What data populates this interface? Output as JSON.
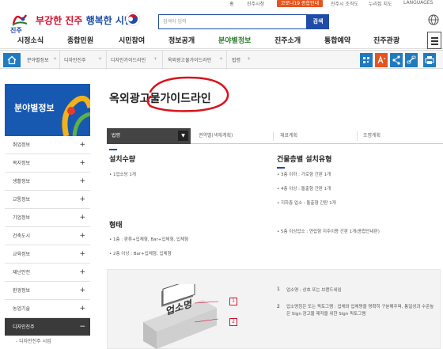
{
  "utility": {
    "home": "홈",
    "city_hall": "진주시청",
    "corona": "코로나19 종합안내",
    "org": "진주시 조직도",
    "sitemap": "누리집 지도",
    "languages": "LANGUAGES"
  },
  "header": {
    "logo_text": "진주",
    "slogan_red": "부강한 진주",
    "slogan_blue": "행복한 시민",
    "search_placeholder": "검색어 입력",
    "search_button": "검색"
  },
  "gnb": {
    "items": [
      "시정소식",
      "종합민원",
      "시민참여",
      "정보공개",
      "분야별정보",
      "진주소개",
      "통합예약",
      "진주관광"
    ],
    "active_index": 4
  },
  "breadcrumb": {
    "items": [
      "분야별정보",
      "디자인진주",
      "디자인가이드라인",
      "옥외광고물가이드라인",
      "법령"
    ]
  },
  "sidebar": {
    "title": "분야별정보",
    "items": [
      "취업정보",
      "복지정보",
      "생활정보",
      "교통정보",
      "기업정보",
      "건축도시",
      "교육정보",
      "재난안전",
      "환경정보",
      "농업기술",
      "디자인진주"
    ],
    "active_index": 10,
    "active_sign": "−",
    "sub_item": "- 디자인진주 시업"
  },
  "main": {
    "title": "옥외광고물가이드라인",
    "tabs": [
      "법령",
      "권역별(색채계획)",
      "재료계획",
      "조명계획"
    ],
    "tab_arrow": "▼",
    "section_qty": {
      "title": "설치수량",
      "items": [
        "1업소당 1개"
      ]
    },
    "section_form": {
      "title": "형태",
      "items": [
        "1층 : 판류+입체형, Bar+입체형, 입체형",
        "2층 이상 : Bar+입체형, 입체형"
      ]
    },
    "section_floor": {
      "title": "건물층별 설치유형",
      "items": [
        "3층 이하 : 가로형 간판 1개",
        "4층 이상 : 돌출형 간판 1개",
        "지하층 업소 : 돌출형 간판 1개",
        "5층 이상업소 : 연립형 지주이용 간판 1개(종합안내판)"
      ]
    },
    "illustration": {
      "sign_text": "업소명",
      "markers": [
        "1",
        "2"
      ],
      "notes": [
        {
          "num": "1",
          "text": "업소명 : 상호 또는 브랜드네임"
        },
        {
          "num": "2",
          "text": "업소명칭은 또는 픽토그램 : 업체와 업체명을 명확히 구분해주며, 통일성과 수준높은 Sign 광고물 제작을 위한 Sign 픽토그램"
        }
      ]
    }
  }
}
